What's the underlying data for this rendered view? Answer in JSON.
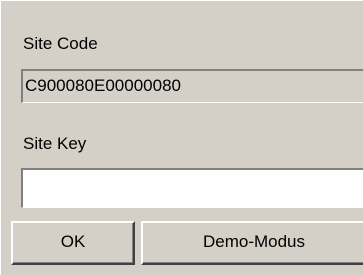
{
  "dialog": {
    "site_code": {
      "label": "Site Code",
      "value": "C900080E00000080"
    },
    "site_key": {
      "label": "Site Key",
      "value": ""
    },
    "buttons": {
      "ok_label": "OK",
      "demo_label": "Demo-Modus"
    }
  }
}
